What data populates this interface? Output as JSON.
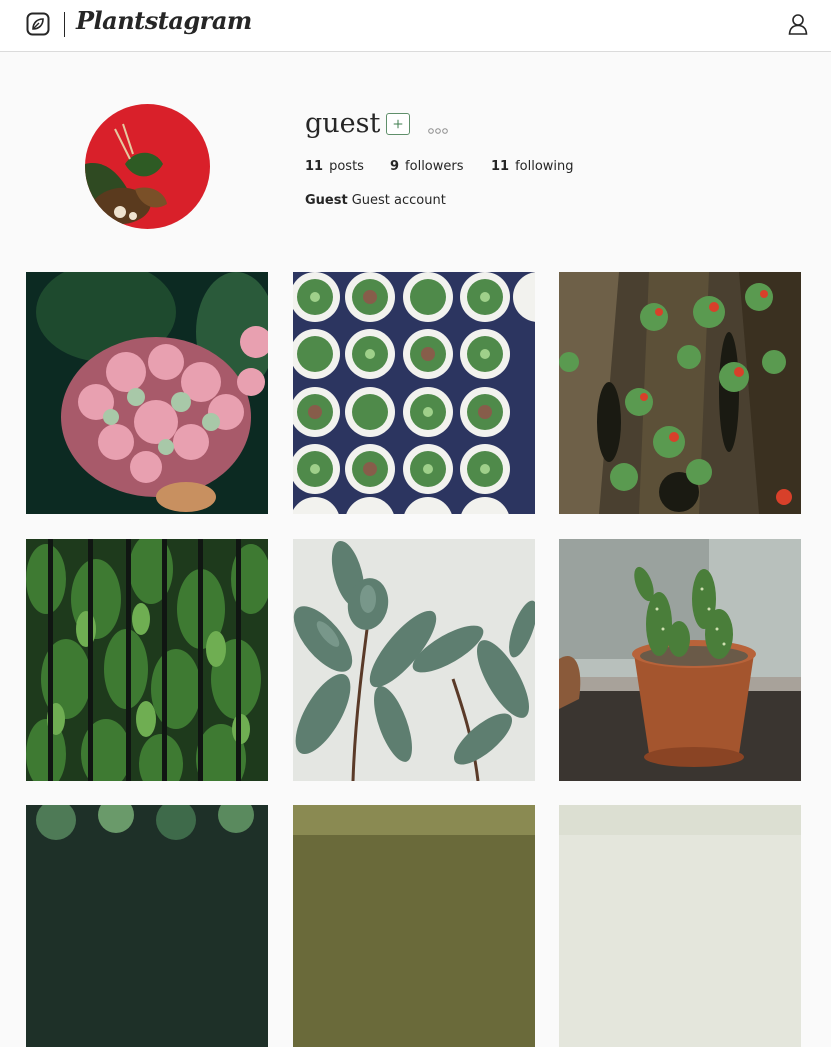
{
  "header": {
    "brand": "Plantstagram",
    "logo_icon": "leaf-icon",
    "profile_icon": "user-icon"
  },
  "profile": {
    "username": "guest",
    "follow_icon": "plus-icon",
    "more_icon": "more-options-icon",
    "stats": {
      "posts_count": "11",
      "posts_label": "posts",
      "followers_count": "9",
      "followers_label": "followers",
      "following_count": "11",
      "following_label": "following"
    },
    "bio_name": "Guest",
    "bio_text": "Guest account"
  },
  "posts": [
    {
      "subject": "pink hydrangea"
    },
    {
      "subject": "succulents in white pots"
    },
    {
      "subject": "bromeliads on tree bark"
    },
    {
      "subject": "cypress hedge behind bars"
    },
    {
      "subject": "rubber plant leaves"
    },
    {
      "subject": "prickly pear cactus in terracotta pot"
    },
    {
      "subject": "succulents"
    },
    {
      "subject": "blurred plant"
    },
    {
      "subject": "light background plant"
    }
  ],
  "colors": {
    "accent": "#3e7d4e",
    "background": "#fafafa",
    "text": "#262626"
  }
}
